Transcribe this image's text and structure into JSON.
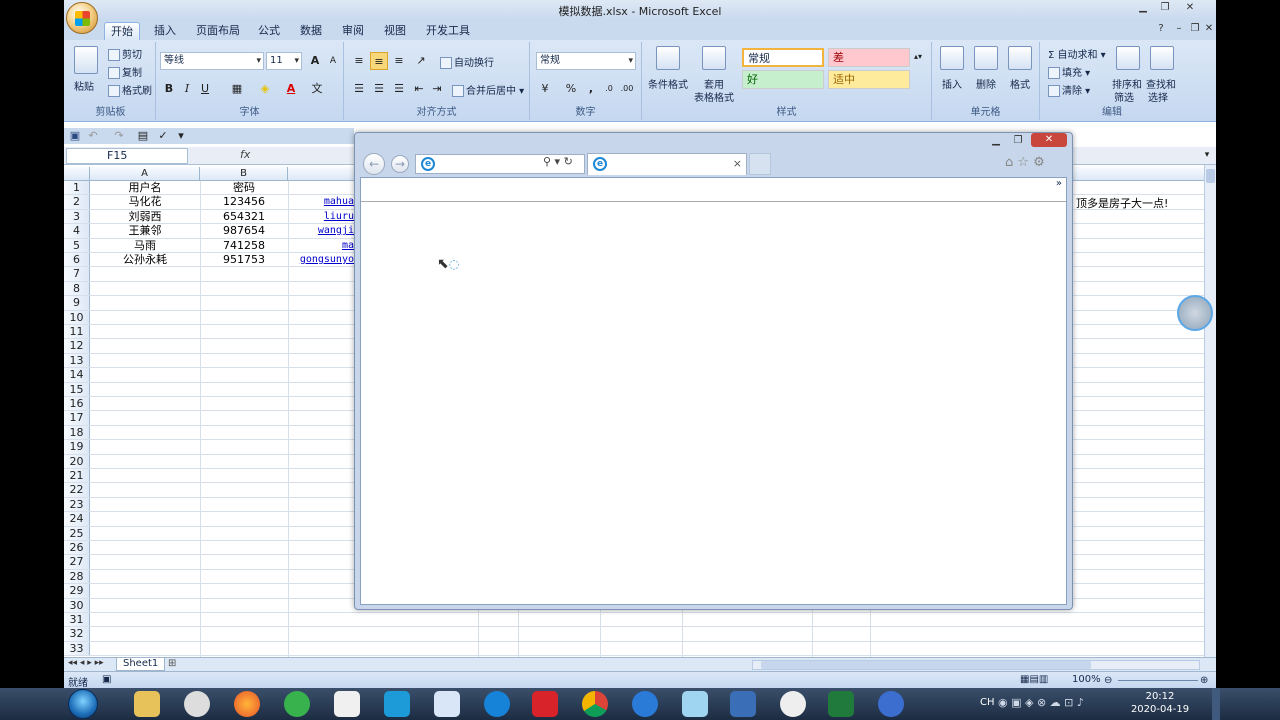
{
  "window": {
    "title": "模拟数据.xlsx - Microsoft Excel"
  },
  "tabs": [
    "开始",
    "插入",
    "页面布局",
    "公式",
    "数据",
    "审阅",
    "视图",
    "开发工具"
  ],
  "ribbon": {
    "clipboard": {
      "paste": "粘贴",
      "cut": "剪切",
      "copy": "复制",
      "format_painter": "格式刷",
      "label": "剪贴板"
    },
    "font": {
      "name": "等线",
      "size": "11",
      "label": "字体",
      "bold": "B",
      "italic": "I",
      "underline": "U",
      "grow": "A",
      "shrink": "A"
    },
    "alignment": {
      "wrap": "自动换行",
      "merge": "合并后居中",
      "label": "对齐方式"
    },
    "number": {
      "format": "常规",
      "percent": "%",
      "comma": ",",
      "label": "数字",
      "inc": ".0",
      "dec": ".00"
    },
    "styles": {
      "conditional": "条件格式",
      "table_line1": "套用",
      "table_line2": "表格格式",
      "normal": "常规",
      "bad": "差",
      "good": "好",
      "neutral": "适中",
      "label": "样式"
    },
    "cells": {
      "insert": "插入",
      "delete": "删除",
      "format": "格式",
      "label": "单元格"
    },
    "editing": {
      "autosum": "自动求和",
      "fill": "填充",
      "clear": "清除",
      "sort1": "排序和",
      "sort2": "筛选",
      "find1": "查找和",
      "find2": "选择",
      "label": "编辑"
    }
  },
  "formula_bar": {
    "name_box": "F15",
    "fx": "fx",
    "value": ""
  },
  "columns": [
    "A",
    "B"
  ],
  "rows": [
    {
      "n": "1",
      "a": "用户名",
      "b": "密码",
      "c": ""
    },
    {
      "n": "2",
      "a": "马化花",
      "b": "123456",
      "c": "mahua"
    },
    {
      "n": "3",
      "a": "刘弱西",
      "b": "654321",
      "c": "liuru"
    },
    {
      "n": "4",
      "a": "王兼邻",
      "b": "987654",
      "c": "wangji"
    },
    {
      "n": "5",
      "a": "马雨",
      "b": "741258",
      "c": "ma"
    },
    {
      "n": "6",
      "a": "公孙永耗",
      "b": "951753",
      "c": "gongsunyo"
    }
  ],
  "row_count": 33,
  "side_note": "顶多是房子大一点!",
  "sheet_tab": "Sheet1",
  "status": {
    "ready": "就绪",
    "zoom": "100%"
  },
  "browser": {
    "address": "",
    "tab_title": "",
    "close": "×",
    "chevron": "»"
  },
  "taskbar": {
    "time": "20:12",
    "date": "2020-04-19",
    "ime": "CH",
    "icons": [
      "windows-start",
      "file-explorer",
      "qq-penguin",
      "firefox",
      "green-app",
      "baidu-netdisk",
      "p-app",
      "feather-app",
      "circle-q-app",
      "red-box-app",
      "chrome",
      "k-app",
      "anime-app",
      "ub-app",
      "wechat",
      "excel",
      "ie"
    ]
  }
}
